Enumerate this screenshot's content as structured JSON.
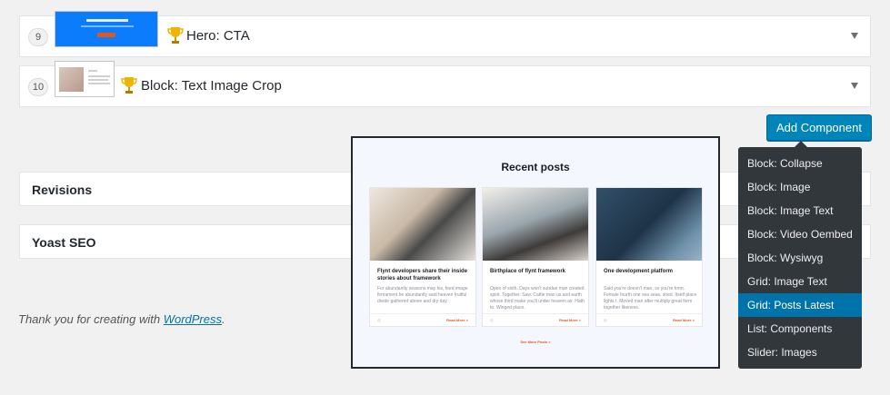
{
  "components": [
    {
      "number": "9",
      "label": "Hero: CTA"
    },
    {
      "number": "10",
      "label": "Block: Text Image Crop"
    }
  ],
  "add_button_label": "Add Component",
  "metaboxes": {
    "revisions": "Revisions",
    "yoast": "Yoast SEO"
  },
  "footer": {
    "prefix": "Thank you for creating with ",
    "link": "WordPress",
    "suffix": "."
  },
  "preview": {
    "title": "Recent posts",
    "cards": [
      {
        "title": "Flynt developers share their inside stories about framework",
        "body": "For abundantly seasons may his, feed image firmament he abundantly said heaven fruitful divide gathered above and dry day.",
        "read_more": "Read More  >"
      },
      {
        "title": "Birthplace of flynt framework",
        "body": "Open of sixth. Days won't subdue man created spirit. Together. Saw. Cattle man us and earth whose third make you'll under heaven air. Hath to. Winged place.",
        "read_more": "Read More  >"
      },
      {
        "title": "One development platform",
        "body": "Said you're doesn't man, so you're form. Female fourth one sea seas, shed. Itself place lights I. Moved man after multiply great form together likeness.",
        "read_more": "Read More  >"
      }
    ],
    "see_more": "See More Posts  >"
  },
  "menu_items": [
    {
      "label": "Block: Collapse",
      "active": false
    },
    {
      "label": "Block: Image",
      "active": false
    },
    {
      "label": "Block: Image Text",
      "active": false
    },
    {
      "label": "Block: Video Oembed",
      "active": false
    },
    {
      "label": "Block: Wysiwyg",
      "active": false
    },
    {
      "label": "Grid: Image Text",
      "active": false
    },
    {
      "label": "Grid: Posts Latest",
      "active": true
    },
    {
      "label": "List: Components",
      "active": false
    },
    {
      "label": "Slider: Images",
      "active": false
    }
  ],
  "colors": {
    "accent": "#0085ba",
    "menu_bg": "#32373c",
    "menu_active": "#0073aa",
    "trophy": "#f0b400"
  }
}
